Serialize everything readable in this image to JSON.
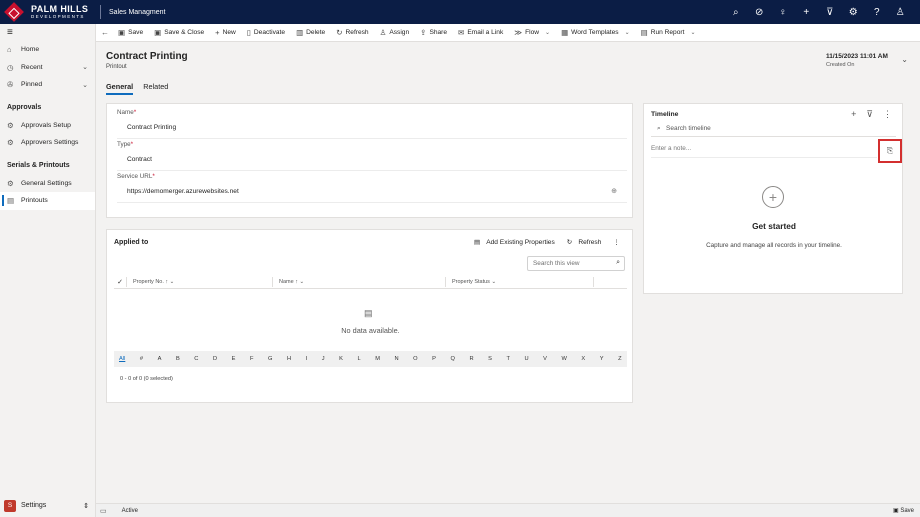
{
  "brand": {
    "line1": "PALM HILLS",
    "line2": "DEVELOPMENTS"
  },
  "app_title": "Sales Managment",
  "top_icons": [
    "search-icon",
    "task-icon",
    "lightbulb-icon",
    "plus-icon",
    "filter-icon",
    "gear-icon",
    "help-icon",
    "person-icon"
  ],
  "sidebar": {
    "hamburger": "≡",
    "items": [
      {
        "label": "Home",
        "icon": "⌂"
      },
      {
        "label": "Recent",
        "icon": "◷"
      },
      {
        "label": "Pinned",
        "icon": "✇"
      }
    ],
    "approvals_header": "Approvals",
    "approvals_items": [
      {
        "label": "Approvals Setup",
        "icon": "⚙"
      },
      {
        "label": "Approvers Settings",
        "icon": "⚙"
      }
    ],
    "serials_header": "Serials & Printouts",
    "serials_items": [
      {
        "label": "General Settings",
        "icon": "⚙"
      },
      {
        "label": "Printouts",
        "icon": "▤"
      }
    ],
    "area": {
      "badge": "S",
      "label": "Settings"
    }
  },
  "commands": {
    "save": "Save",
    "save_close": "Save & Close",
    "new": "New",
    "deactivate": "Deactivate",
    "delete": "Delete",
    "refresh": "Refresh",
    "assign": "Assign",
    "share": "Share",
    "email_link": "Email a Link",
    "flow": "Flow",
    "word_templates": "Word Templates",
    "run_report": "Run Report"
  },
  "record": {
    "title": "Contract Printing",
    "entity": "Printout",
    "created_value": "11/15/2023 11:01 AM",
    "created_label": "Created On"
  },
  "tabs": [
    "General",
    "Related"
  ],
  "form": {
    "name_label": "Name",
    "name_value": "Contract Printing",
    "type_label": "Type",
    "type_value": "Contract",
    "url_label": "Service URL",
    "url_value": "https://demomerger.azurewebsites.net",
    "required_mark": "*"
  },
  "applied": {
    "title": "Applied to",
    "add_existing": "Add Existing Properties",
    "refresh": "Refresh",
    "search_placeholder": "Search this view",
    "columns": [
      "Property No.",
      "Name",
      "Property Status"
    ],
    "no_data": "No data available.",
    "alphabet": [
      "All",
      "#",
      "A",
      "B",
      "C",
      "D",
      "E",
      "F",
      "G",
      "H",
      "I",
      "J",
      "K",
      "L",
      "M",
      "N",
      "O",
      "P",
      "Q",
      "R",
      "S",
      "T",
      "U",
      "V",
      "W",
      "X",
      "Y",
      "Z"
    ],
    "count": "0 - 0 of 0 (0 selected)"
  },
  "timeline": {
    "title": "Timeline",
    "search_placeholder": "Search timeline",
    "note_placeholder": "Enter a note...",
    "get_started": "Get started",
    "capture_text": "Capture and manage all records in your timeline."
  },
  "status": {
    "state": "Active",
    "save": "Save"
  }
}
